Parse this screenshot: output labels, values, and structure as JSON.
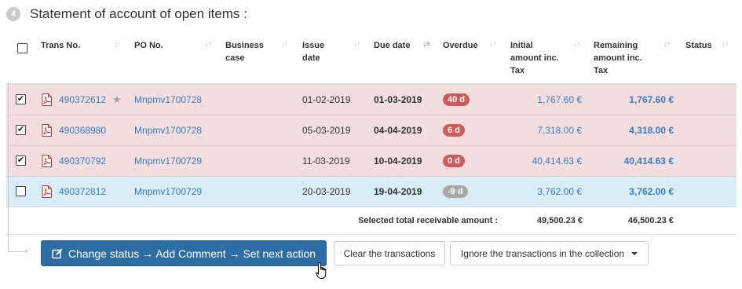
{
  "header": {
    "step_number": "4",
    "title": "Statement of account of open items :"
  },
  "table": {
    "columns": {
      "trans_no": "Trans No.",
      "po_no": "PO No.",
      "business_case_1": "Business",
      "business_case_2": "case",
      "issue_date_1": "Issue",
      "issue_date_2": "date",
      "due_date": "Due date",
      "overdue": "Overdue",
      "initial_1": "Initial",
      "initial_2": "amount inc.",
      "initial_3": "Tax",
      "remaining_1": "Remaining",
      "remaining_2": "amount inc.",
      "remaining_3": "Tax",
      "status": "Status"
    },
    "rows": [
      {
        "checked": "✔",
        "trans_no": "490372612",
        "starred": true,
        "po_no": "Mnpmv1700728",
        "issue_date": "01-02-2019",
        "due_date": "01-03-2019",
        "overdue": "40 d",
        "initial": "1,767.60 €",
        "remaining": "1,767.60 €"
      },
      {
        "checked": "✔",
        "trans_no": "490368980",
        "starred": false,
        "po_no": "Mnpmv1700728",
        "issue_date": "05-03-2019",
        "due_date": "04-04-2019",
        "overdue": "6 d",
        "initial": "7,318.00 €",
        "remaining": "4,318.00 €"
      },
      {
        "checked": "✔",
        "trans_no": "490370792",
        "starred": false,
        "po_no": "Mnpmv1700729",
        "issue_date": "11-03-2019",
        "due_date": "10-04-2019",
        "overdue": "0 d",
        "initial": "40,414.63 €",
        "remaining": "40,414.63 €"
      },
      {
        "checked": "",
        "trans_no": "490372812",
        "starred": false,
        "po_no": "Mnpmv1700729",
        "issue_date": "20-03-2019",
        "due_date": "19-04-2019",
        "overdue": "-9 d",
        "initial": "3,762.00 €",
        "remaining": "3,762.00 €"
      }
    ],
    "total": {
      "label": "Selected total receivable amount :",
      "initial": "49,500.23 €",
      "remaining": "46,500.23 €"
    }
  },
  "actions": {
    "primary_label": "Change status → Add Comment → Set next action",
    "clear_label": "Clear the transactions",
    "ignore_label": "Ignore the transactions in the collection"
  },
  "colors": {
    "overdue_row_bg": "#f2dede",
    "info_row_bg": "#d9edf7",
    "primary_button": "#2e6da4",
    "link": "#3a7bc0",
    "overdue_badge": "#d15b5b",
    "future_badge": "#a8a8a8"
  }
}
